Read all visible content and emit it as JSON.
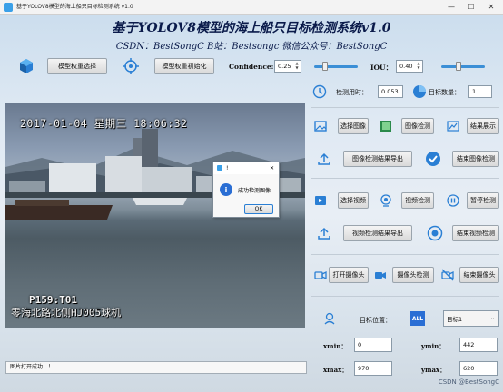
{
  "window": {
    "title": "基于YOLOV8模型的海上船只目标检测系统 v1.0",
    "minimize": "—",
    "maximize": "☐",
    "close": "✕"
  },
  "header": {
    "title": "基于YOLOV8模型的海上船只目标检测系统v1.0",
    "subtitle": "CSDN：BestSongC   B站：Bestsongc   微信公众号：BestSongC"
  },
  "toolbar": {
    "model_select_label": "模型权重选择",
    "model_init_label": "模型权重初始化",
    "confidence_label": "Confidence:",
    "confidence_value": "0.25",
    "confidence_level": 0.25,
    "iou_label": "IOU：",
    "iou_value": "0.40",
    "iou_level": 0.4
  },
  "video": {
    "timestamp": "2017-01-04 星期三 18:06:32",
    "code": "P159:T01",
    "location": "零海北路北侧HJ005球机"
  },
  "dialog": {
    "title": "!",
    "message": "成功检测图像",
    "ok_label": "OK",
    "close": "✕"
  },
  "stats": {
    "time_label": "检测用时：",
    "time_value": "0.053",
    "count_label": "目标数量：",
    "count_value": "1"
  },
  "image_section": {
    "select_label": "选择图像",
    "detect_label": "图像检测",
    "show_label": "结果展示",
    "export_label": "图像检测结果导出",
    "end_label": "结束图像检测"
  },
  "video_section": {
    "select_label": "选择视频",
    "detect_label": "视频检测",
    "pause_label": "暂停检测",
    "export_label": "视频检测结果导出",
    "end_label": "结束视频检测"
  },
  "camera_section": {
    "open_label": "打开摄像头",
    "detect_label": "摄像头检测",
    "end_label": "结束摄像头"
  },
  "target": {
    "position_label": "目标位置：",
    "all_label": "ALL",
    "selected": "目标1",
    "xmin_label": "xmin：",
    "xmin_value": "0",
    "ymin_label": "ymin：",
    "ymin_value": "442",
    "xmax_label": "xmax：",
    "xmax_value": "970",
    "ymax_label": "ymax：",
    "ymax_value": "620"
  },
  "status": {
    "text": "图片打开成功！！"
  },
  "watermark": "CSDN @BestSongC",
  "colors": {
    "accent": "#2a7fd4",
    "title": "#0a1a4a"
  }
}
